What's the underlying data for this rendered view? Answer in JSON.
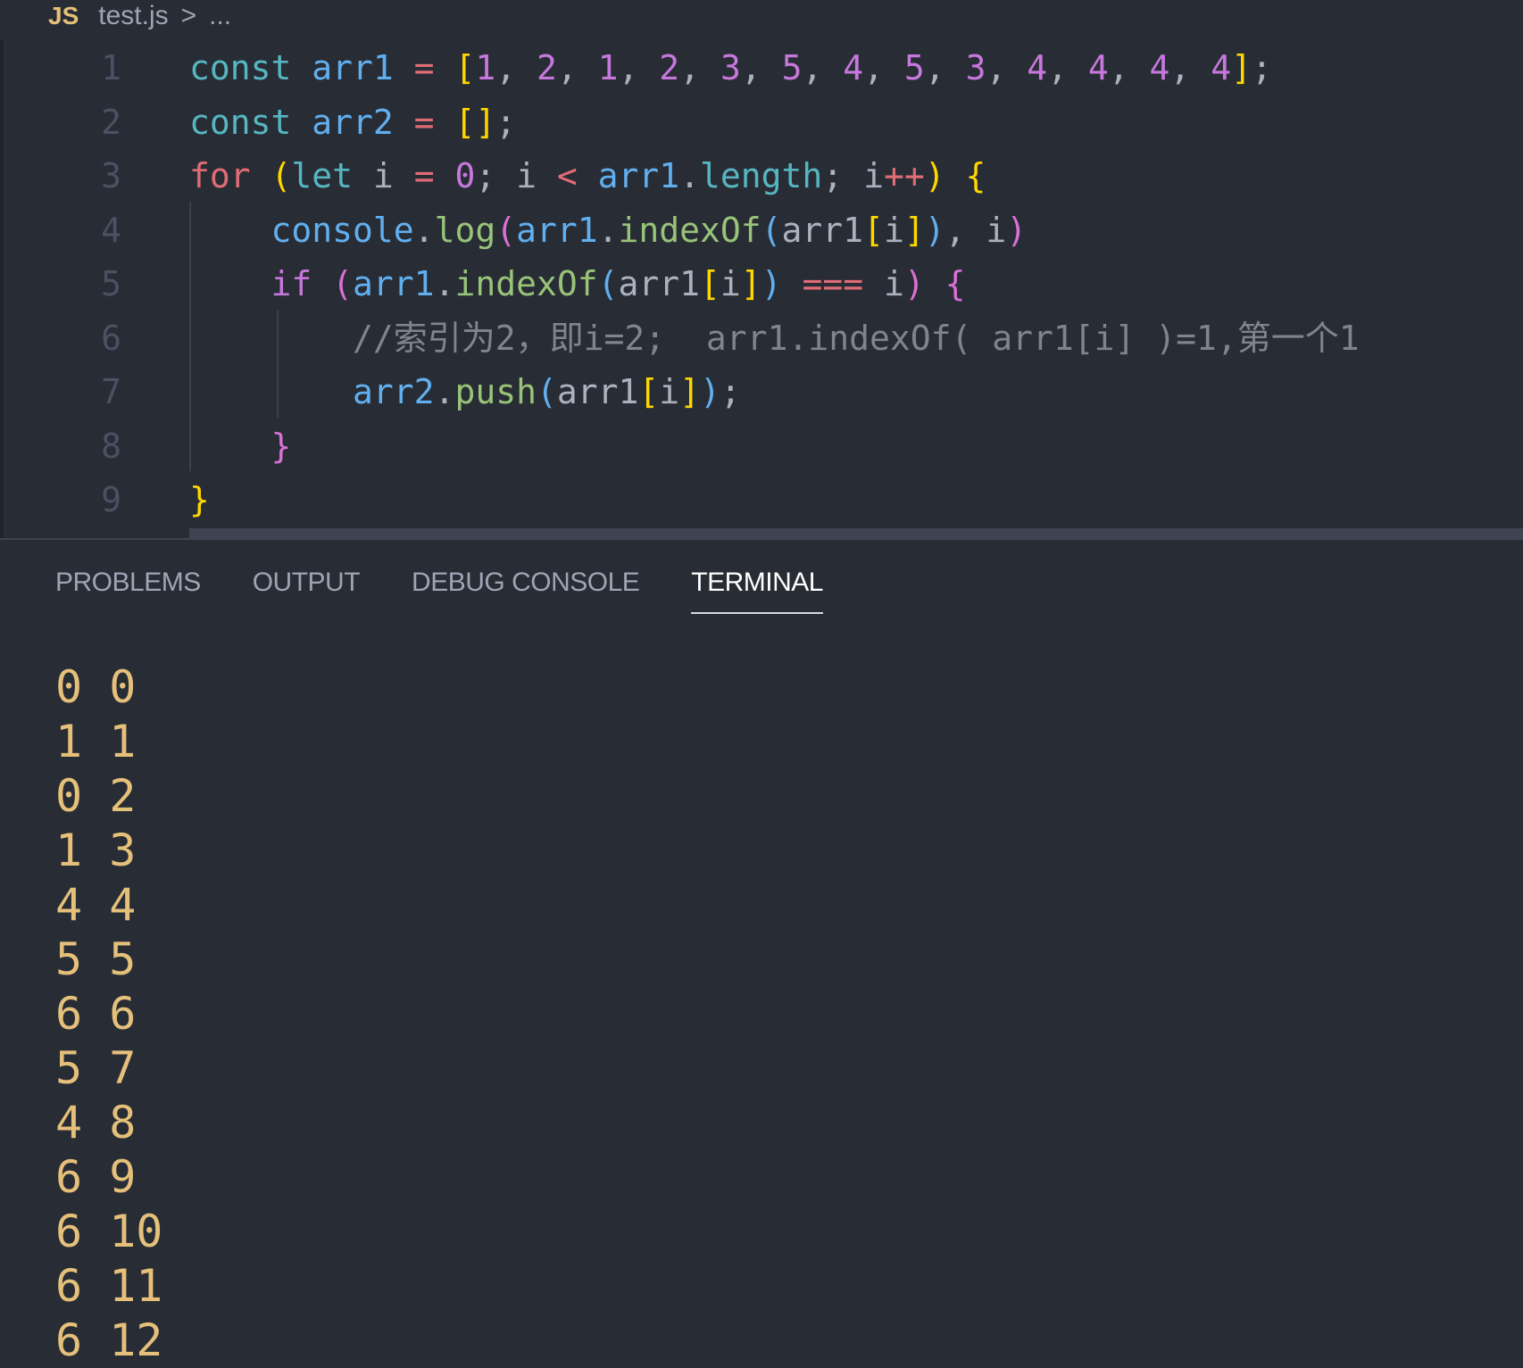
{
  "breadcrumb": {
    "icon_label": "JS",
    "file": "test.js",
    "separator": ">",
    "ellipsis": "..."
  },
  "editor": {
    "line_numbers": [
      "1",
      "2",
      "3",
      "4",
      "5",
      "6",
      "7",
      "8",
      "9"
    ],
    "lines": [
      [
        {
          "t": "const ",
          "c": "k-const"
        },
        {
          "t": "arr1",
          "c": "var"
        },
        {
          "t": " = ",
          "c": "op"
        },
        {
          "t": "[",
          "c": "br1"
        },
        {
          "t": "1",
          "c": "num"
        },
        {
          "t": ", ",
          "c": "plain"
        },
        {
          "t": "2",
          "c": "num"
        },
        {
          "t": ", ",
          "c": "plain"
        },
        {
          "t": "1",
          "c": "num"
        },
        {
          "t": ", ",
          "c": "plain"
        },
        {
          "t": "2",
          "c": "num"
        },
        {
          "t": ", ",
          "c": "plain"
        },
        {
          "t": "3",
          "c": "num"
        },
        {
          "t": ", ",
          "c": "plain"
        },
        {
          "t": "5",
          "c": "num"
        },
        {
          "t": ", ",
          "c": "plain"
        },
        {
          "t": "4",
          "c": "num"
        },
        {
          "t": ", ",
          "c": "plain"
        },
        {
          "t": "5",
          "c": "num"
        },
        {
          "t": ", ",
          "c": "plain"
        },
        {
          "t": "3",
          "c": "num"
        },
        {
          "t": ", ",
          "c": "plain"
        },
        {
          "t": "4",
          "c": "num"
        },
        {
          "t": ", ",
          "c": "plain"
        },
        {
          "t": "4",
          "c": "num"
        },
        {
          "t": ", ",
          "c": "plain"
        },
        {
          "t": "4",
          "c": "num"
        },
        {
          "t": ", ",
          "c": "plain"
        },
        {
          "t": "4",
          "c": "num"
        },
        {
          "t": "]",
          "c": "br1"
        },
        {
          "t": ";",
          "c": "plain"
        }
      ],
      [
        {
          "t": "const ",
          "c": "k-const"
        },
        {
          "t": "arr2",
          "c": "var"
        },
        {
          "t": " = ",
          "c": "op"
        },
        {
          "t": "[]",
          "c": "br1"
        },
        {
          "t": ";",
          "c": "plain"
        }
      ],
      [
        {
          "t": "for ",
          "c": "k-for"
        },
        {
          "t": "(",
          "c": "br1"
        },
        {
          "t": "let ",
          "c": "k-const"
        },
        {
          "t": "i ",
          "c": "plain"
        },
        {
          "t": "= ",
          "c": "op"
        },
        {
          "t": "0",
          "c": "num"
        },
        {
          "t": "; i ",
          "c": "plain"
        },
        {
          "t": "< ",
          "c": "op"
        },
        {
          "t": "arr1",
          "c": "var"
        },
        {
          "t": ".",
          "c": "plain"
        },
        {
          "t": "length",
          "c": "prop"
        },
        {
          "t": "; i",
          "c": "plain"
        },
        {
          "t": "++",
          "c": "op"
        },
        {
          "t": ") ",
          "c": "br1"
        },
        {
          "t": "{",
          "c": "br1"
        }
      ],
      [
        {
          "t": "    ",
          "c": "plain"
        },
        {
          "t": "console",
          "c": "var"
        },
        {
          "t": ".",
          "c": "plain"
        },
        {
          "t": "log",
          "c": "fn"
        },
        {
          "t": "(",
          "c": "br2"
        },
        {
          "t": "arr1",
          "c": "var"
        },
        {
          "t": ".",
          "c": "plain"
        },
        {
          "t": "indexOf",
          "c": "fn"
        },
        {
          "t": "(",
          "c": "br3"
        },
        {
          "t": "arr1",
          "c": "plain"
        },
        {
          "t": "[",
          "c": "br1"
        },
        {
          "t": "i",
          "c": "plain"
        },
        {
          "t": "]",
          "c": "br1"
        },
        {
          "t": ")",
          "c": "br3"
        },
        {
          "t": ", i",
          "c": "plain"
        },
        {
          "t": ")",
          "c": "br2"
        }
      ],
      [
        {
          "t": "    ",
          "c": "plain"
        },
        {
          "t": "if ",
          "c": "k-ctrl"
        },
        {
          "t": "(",
          "c": "br2"
        },
        {
          "t": "arr1",
          "c": "var"
        },
        {
          "t": ".",
          "c": "plain"
        },
        {
          "t": "indexOf",
          "c": "fn"
        },
        {
          "t": "(",
          "c": "br3"
        },
        {
          "t": "arr1",
          "c": "plain"
        },
        {
          "t": "[",
          "c": "br1"
        },
        {
          "t": "i",
          "c": "plain"
        },
        {
          "t": "]",
          "c": "br1"
        },
        {
          "t": ") ",
          "c": "br3"
        },
        {
          "t": "=== ",
          "c": "op"
        },
        {
          "t": "i",
          "c": "plain"
        },
        {
          "t": ") ",
          "c": "br2"
        },
        {
          "t": "{",
          "c": "br2"
        }
      ],
      [
        {
          "t": "        ",
          "c": "plain"
        },
        {
          "t": "//索引为2，即i=2;  arr1.indexOf( arr1[i] )=1,第一个1",
          "c": "cmt"
        }
      ],
      [
        {
          "t": "        ",
          "c": "plain"
        },
        {
          "t": "arr2",
          "c": "var"
        },
        {
          "t": ".",
          "c": "plain"
        },
        {
          "t": "push",
          "c": "fn"
        },
        {
          "t": "(",
          "c": "br3"
        },
        {
          "t": "arr1",
          "c": "plain"
        },
        {
          "t": "[",
          "c": "br1"
        },
        {
          "t": "i",
          "c": "plain"
        },
        {
          "t": "]",
          "c": "br1"
        },
        {
          "t": ")",
          "c": "br3"
        },
        {
          "t": ";",
          "c": "plain"
        }
      ],
      [
        {
          "t": "    ",
          "c": "plain"
        },
        {
          "t": "}",
          "c": "br2"
        }
      ],
      [
        {
          "t": "}",
          "c": "br1"
        }
      ]
    ]
  },
  "panel": {
    "tabs": [
      {
        "label": "PROBLEMS",
        "active": false
      },
      {
        "label": "OUTPUT",
        "active": false
      },
      {
        "label": "DEBUG CONSOLE",
        "active": false
      },
      {
        "label": "TERMINAL",
        "active": true
      }
    ]
  },
  "terminal": {
    "lines": [
      "0 0",
      "1 1",
      "0 2",
      "1 3",
      "4 4",
      "5 5",
      "6 6",
      "5 7",
      "4 8",
      "6 9",
      "6 10",
      "6 11",
      "6 12"
    ]
  },
  "colors": {
    "background": "#282c34",
    "terminal_text": "#e5c07b",
    "active_tab_underline": "#d7dae0"
  }
}
